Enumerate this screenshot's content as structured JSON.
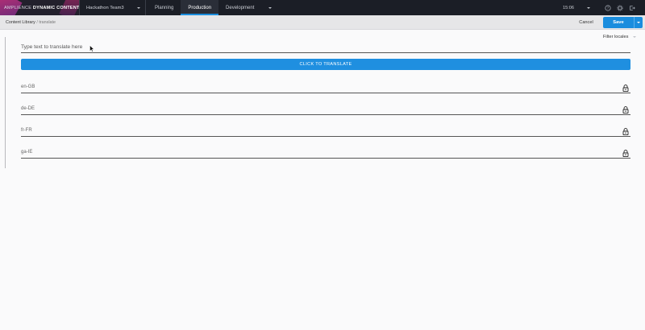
{
  "brand": {
    "prefix": "AMPLIENCE",
    "name": "DYNAMIC CONTENT"
  },
  "hub": {
    "label": "Hackathon Team3"
  },
  "nav": {
    "tabs": [
      {
        "label": "Planning"
      },
      {
        "label": "Production"
      },
      {
        "label": "Development"
      }
    ]
  },
  "top_right": {
    "time": "15:06"
  },
  "subbar": {
    "breadcrumb": {
      "root": "Content Library",
      "separator": "/",
      "current": "translate"
    },
    "cancel_label": "Cancel",
    "save_label": "Save"
  },
  "content": {
    "filter_label": "Filter locales",
    "input_placeholder": "Type text to translate here",
    "translate_label": "CLICK TO TRANSLATE",
    "locales": [
      "en-GB",
      "de-DE",
      "fr-FR",
      "ga-IE"
    ]
  },
  "colors": {
    "accent": "#1a8dde",
    "topbar": "#1b1e26",
    "subbar": "#e6e6e8"
  }
}
